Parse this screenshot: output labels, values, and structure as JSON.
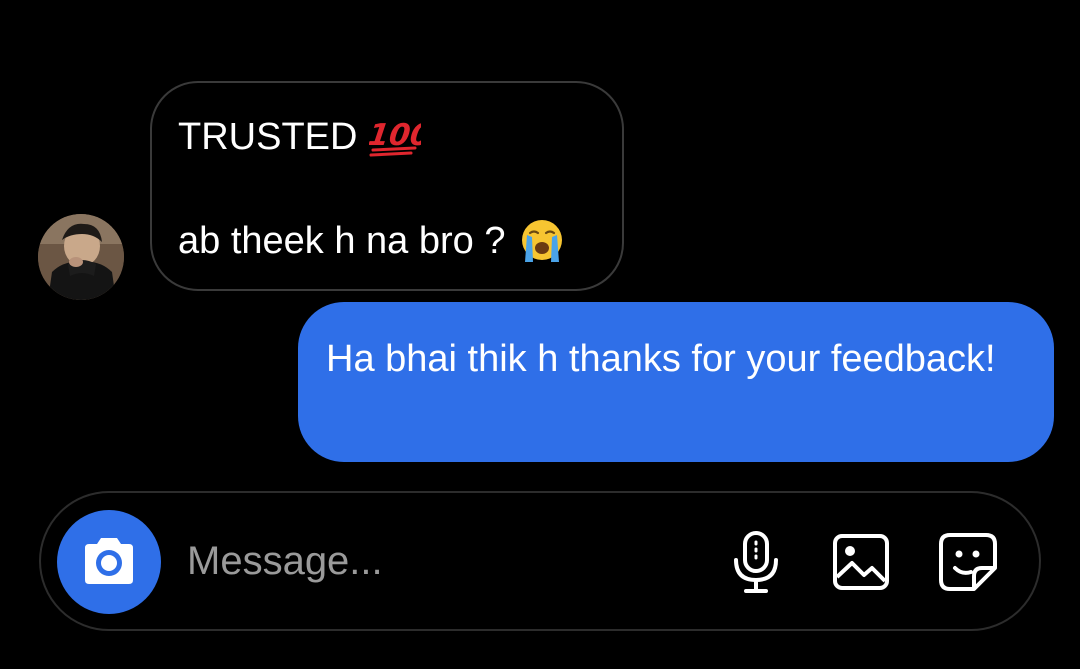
{
  "thread": {
    "incoming_message": {
      "line1": "TRUSTED",
      "line1_emoji": "hundred-points-emoji",
      "line2": "ab theek h na bro ?",
      "line2_emoji": "crying-face-emoji"
    },
    "outgoing_message": {
      "text": "Ha bhai thik h thanks for your feedback!"
    }
  },
  "composer": {
    "placeholder": "Message...",
    "buttons": [
      "camera-icon",
      "microphone-icon",
      "gallery-icon",
      "sticker-icon"
    ]
  },
  "colors": {
    "background": "#000000",
    "outgoing_bubble": "#2f6fe8",
    "accent": "#2f6fe8",
    "bubble_border": "#3a3a3a",
    "placeholder": "#9a9a9a"
  }
}
